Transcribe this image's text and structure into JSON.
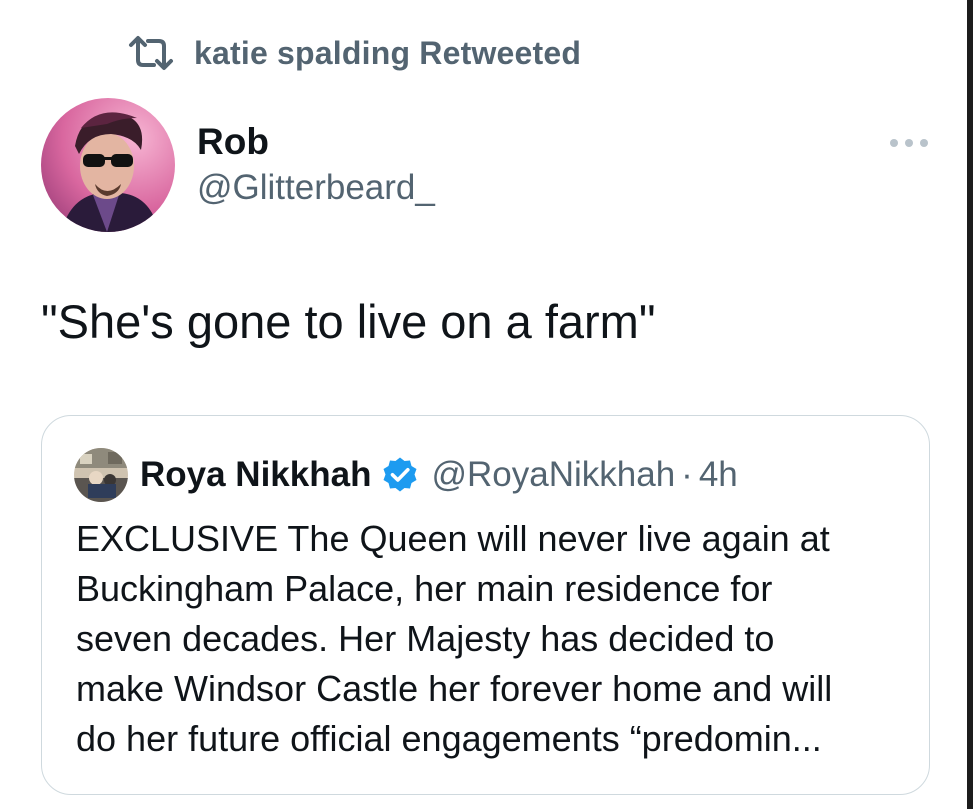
{
  "retweet": {
    "icon": "retweet-icon",
    "text": "katie spalding Retweeted"
  },
  "author": {
    "avatar": "avatar",
    "name": "Rob",
    "handle": "@Glitterbeard_"
  },
  "more": {
    "icon": "more-horizontal-icon"
  },
  "tweet": {
    "text": "\"She's gone to live on a farm\""
  },
  "quote": {
    "avatar": "avatar",
    "name": "Roya Nikkhah",
    "verified_icon": "verified-badge-icon",
    "handle": "@RoyaNikkhah",
    "separator": "·",
    "time": "4h",
    "lines": [
      "EXCLUSIVE The Queen will never live again at",
      "Buckingham Palace, her main residence for",
      "seven decades. Her Majesty has decided to",
      "make Windsor Castle her forever home and will",
      "do her future official engagements “predomin..."
    ]
  },
  "colors": {
    "text_primary": "#0f1419",
    "text_secondary": "#536471",
    "verified_blue": "#1d9bf0",
    "border": "#cfd9de"
  }
}
